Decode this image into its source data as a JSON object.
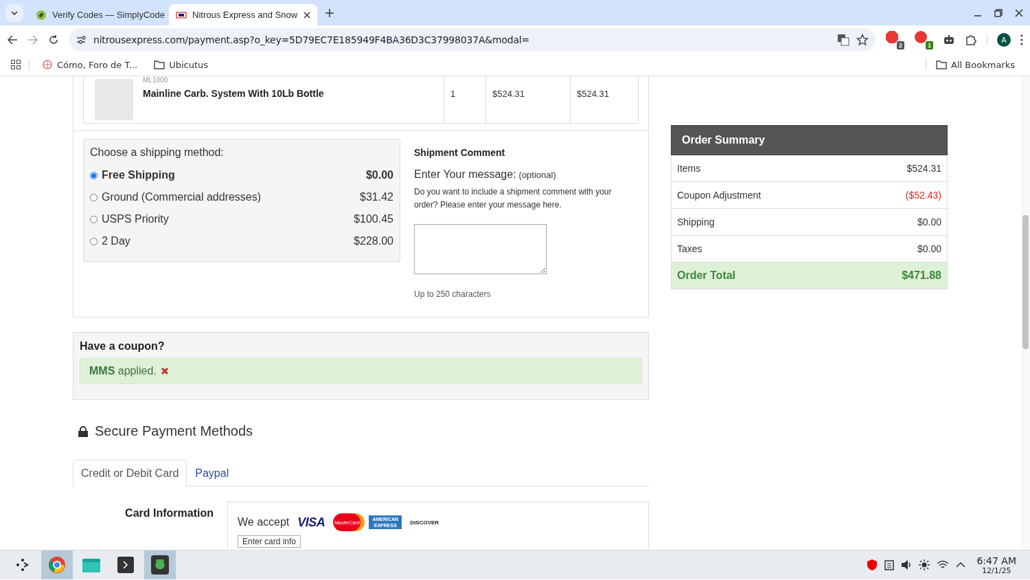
{
  "browser": {
    "tabs": [
      {
        "title": "Verify Codes — SimplyCode",
        "selected": false
      },
      {
        "title": "Nitrous Express and Snow",
        "selected": true
      }
    ],
    "address": "nitrousexpress.com/payment.asp?o_key=5D79EC7E185949F4BA36D3C37998037A&modal=",
    "extension_badges": [
      "2",
      "1"
    ],
    "profile": "A",
    "bookmarks": [
      {
        "label": "Cómo, Foro de T...",
        "kind": "site"
      },
      {
        "label": "Ubicutus",
        "kind": "folder"
      }
    ],
    "all_bookmarks": "All Bookmarks"
  },
  "cart": {
    "sku": "ML1000",
    "name": "Mainline Carb. System With 10Lb Bottle",
    "qty": "1",
    "price": "$524.31",
    "total": "$524.31"
  },
  "shipping": {
    "title": "Choose a shipping method:",
    "options": [
      {
        "label": "Free Shipping",
        "price": "$0.00",
        "selected": true
      },
      {
        "label": "Ground (Commercial addresses)",
        "price": "$31.42",
        "selected": false
      },
      {
        "label": "USPS Priority",
        "price": "$100.45",
        "selected": false
      },
      {
        "label": "2 Day",
        "price": "$228.00",
        "selected": false
      }
    ]
  },
  "comment": {
    "title": "Shipment Comment",
    "prompt": "Enter Your message:",
    "optional": "(optional)",
    "description": "Do you want to include a shipment comment with your order? Please enter your message here.",
    "limit": "Up to 250 characters"
  },
  "coupon": {
    "title": "Have a coupon?",
    "message": "**MMS** applied."
  },
  "payment": {
    "title": "Secure Payment Methods",
    "tabs": [
      {
        "label": "Credit or Debit Card",
        "selected": true
      },
      {
        "label": "Paypal",
        "selected": false
      }
    ],
    "card_label": "Card Information",
    "we_accept": "We accept",
    "cards": [
      {
        "kind": "visa",
        "label": "VISA"
      },
      {
        "kind": "mastercard",
        "label": "MasterCard"
      },
      {
        "kind": "amex",
        "label": "AMERICAN EXPRESS"
      },
      {
        "kind": "discover",
        "label": "DISCOVER"
      }
    ],
    "enter_button": "Enter card info"
  },
  "summary": {
    "title": "Order Summary",
    "rows": [
      {
        "label": "Items",
        "value": "$524.31",
        "kind": "normal"
      },
      {
        "label": "Coupon Adjustment",
        "value": "($52.43)",
        "kind": "discount"
      },
      {
        "label": "Shipping",
        "value": "$0.00",
        "kind": "normal"
      },
      {
        "label": "Taxes",
        "value": "$0.00",
        "kind": "normal"
      },
      {
        "label": "Order Total",
        "value": "$471.88",
        "kind": "total"
      }
    ]
  },
  "taskbar": {
    "time": "6:47 AM",
    "date": "12/1/25"
  }
}
